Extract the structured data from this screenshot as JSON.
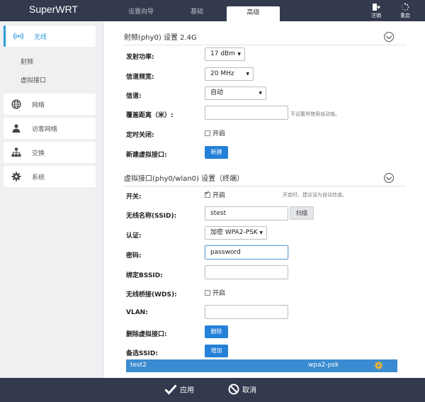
{
  "header": {
    "brand": "SuperWRT",
    "tabs": [
      {
        "label": "设置向导"
      },
      {
        "label": "基础"
      },
      {
        "label": "高级"
      }
    ],
    "logout_label": "注销",
    "reboot_label": "重启"
  },
  "sidebar": {
    "items": [
      {
        "label": "无线",
        "icon": "wifi-icon"
      },
      {
        "label": "网络",
        "icon": "globe-icon"
      },
      {
        "label": "访客网络",
        "icon": "user-icon"
      },
      {
        "label": "交换",
        "icon": "switch-icon"
      },
      {
        "label": "系统",
        "icon": "gear-icon"
      }
    ],
    "subitems": [
      {
        "label": "射频"
      },
      {
        "label": "虚拟接口"
      }
    ]
  },
  "radio": {
    "title": "射频(phy0) 设置 2.4G",
    "tx_power_label": "发射功率:",
    "tx_power_value": "17 dBm",
    "channel_width_label": "信道频宽:",
    "channel_width_value": "20 MHz",
    "channel_label": "信道:",
    "channel_value": "自动",
    "coverage_label": "覆盖距离（米）:",
    "coverage_value": "",
    "coverage_hint": "不设置将使用自动值。",
    "timer_off_label": "定时关闭:",
    "timer_off_text": "开启",
    "new_vif_label": "新建虚拟接口:",
    "new_vif_button": "新建"
  },
  "vif": {
    "title": "虚拟接口(phy0/wlan0) 设置（终端）",
    "switch_label": "开关:",
    "switch_text": "开启",
    "switch_hint": "开启时，建议设为自动信道。",
    "ssid_label": "无线名称(SSID):",
    "ssid_value": "stest",
    "scan_button": "扫描",
    "auth_label": "认证:",
    "auth_value": "加密 WPA2-PSK",
    "password_label": "密码:",
    "password_value": "password",
    "bssid_label": "绑定BSSID:",
    "bssid_value": "",
    "wds_label": "无线桥接(WDS):",
    "wds_text": "开启",
    "vlan_label": "VLAN:",
    "vlan_value": "",
    "delete_vif_label": "删除虚拟接口:",
    "delete_button": "删除",
    "backup_ssid_label": "备选SSID:",
    "add_button": "增加",
    "backup_ssids": [
      {
        "name": "test2",
        "encryption": "wpa2-psk"
      }
    ]
  },
  "footer": {
    "apply_label": "应用",
    "cancel_label": "取消"
  },
  "colors": {
    "header_bg": "#333a4e",
    "accent": "#2c9ad8",
    "button_blue": "#2580d8"
  }
}
